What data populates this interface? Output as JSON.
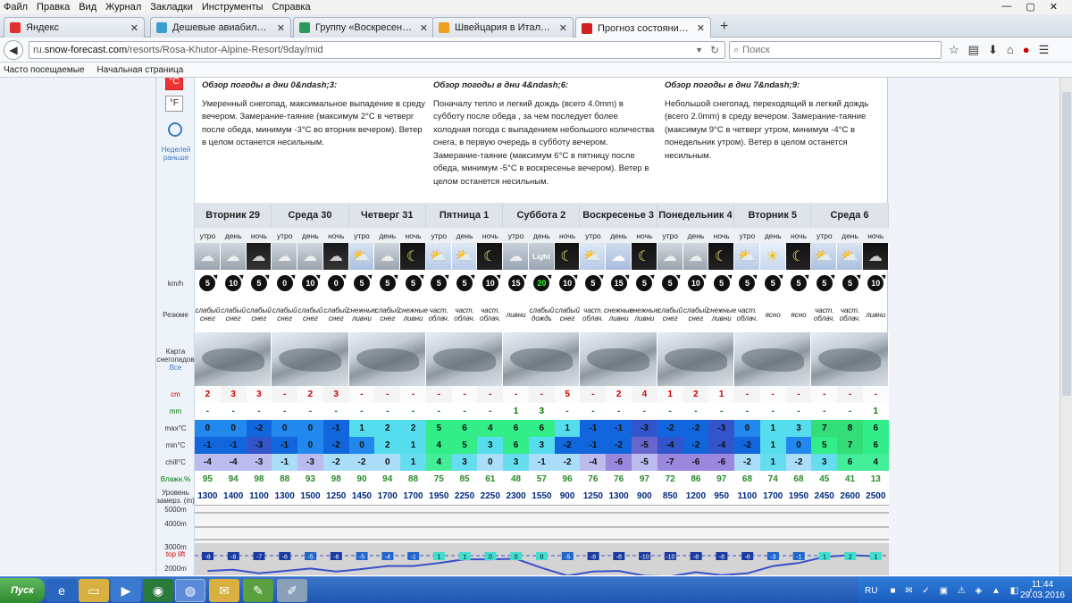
{
  "menu": [
    "Файл",
    "Правка",
    "Вид",
    "Журнал",
    "Закладки",
    "Инструменты",
    "Справка"
  ],
  "tabs": [
    {
      "title": "Яндекс",
      "color": "#e03030"
    },
    {
      "title": "Дешевые авиабилеты Моск...",
      "color": "#3aa0d0"
    },
    {
      "title": "Группу «Воскресенье» заки...",
      "color": "#2a9a5a"
    },
    {
      "title": "Швейцария в Италии, или н...",
      "color": "#f0a020"
    },
    {
      "title": "Прогноз состояния снега и ...",
      "color": "#d02020"
    }
  ],
  "url": {
    "prefix": "ru.",
    "host": "snow-forecast.com",
    "path": "/resorts/Rosa-Khutor-Alpine-Resort/9day/mid"
  },
  "search_placeholder": "Поиск",
  "bookmarks": [
    "Часто посещаемые",
    "Начальная страница"
  ],
  "left_panel": {
    "c_label": "°C",
    "f_label": "°F",
    "earlier": "Неделей раньше"
  },
  "overview": [
    {
      "title": "Обзор погоды в дни 0&ndash;3:",
      "text": "Умеренный снегопад, максимальное выпадение в среду вечером. Замерание-таяние (максимум 2°C в четверг после обеда, минимум -3°C во вторник вечером). Ветер в целом останется несильным."
    },
    {
      "title": "Обзор погоды в дни 4&ndash;6:",
      "text": "Поначалу тепло и легкий дождь (всего 4.0mm) в субботу после обеда , за чем последует более холодная погода с выпадением небольшого количества снега, в первую очередь в субботу вечером. Замерание-таяние (максимум 6°C в пятницу после обеда, минимум -5°C в воскресенье вечером). Ветер в целом останется несильным."
    },
    {
      "title": "Обзор погоды в дни 7&ndash;9:",
      "text": "Небольшой снегопад, переходящий в легкий дождь (всего 2.0mm) в среду вечером. Замерание-таяние (максимум 9°C в четверг утром, минимум -4°C в понедельник утром). Ветер в целом останется несильным."
    }
  ],
  "row_labels": {
    "wind": "km/h",
    "summary": "Резюме",
    "map": "Карта снегопадов",
    "map_link": "Все",
    "snow": "cm",
    "rain": "mm",
    "max": "max°C",
    "min": "min°C",
    "chill": "chill°C",
    "humidity": "Влажн.%",
    "freezing": "Уровень замерз. (m)",
    "top_lift": "top lift"
  },
  "days": [
    "Вторник 29",
    "Среда 30",
    "Четверг 31",
    "Пятница 1",
    "Суббота 2",
    "Воскресенье 3",
    "Понедельник 4",
    "Вторник 5",
    "Среда 6"
  ],
  "periods": [
    "утро",
    "день",
    "ночь"
  ],
  "weather_types": [
    "snow",
    "snow",
    "snow-night",
    "snow",
    "snow",
    "snow-night",
    "cloud-sun",
    "snow",
    "moon",
    "sun-cloud",
    "sun-cloud",
    "moon",
    "cloud-light",
    "cloud-light",
    "moon",
    "sun-cloud",
    "cloud-snow",
    "moon",
    "snow",
    "snow",
    "moon",
    "sun-cloud",
    "sun",
    "moon",
    "cloud-sun",
    "cloud-sun",
    "rain-night"
  ],
  "light_label": "Light",
  "wind": [
    "5",
    "10",
    "5",
    "0",
    "10",
    "0",
    "5",
    "5",
    "5",
    "5",
    "5",
    "10",
    "15",
    "20",
    "10",
    "5",
    "15",
    "5",
    "5",
    "10",
    "5",
    "5",
    "5",
    "5",
    "5",
    "5",
    "10"
  ],
  "summary": [
    "слабый снег",
    "слабый снег",
    "слабый снег",
    "слабый снег",
    "слабый снег",
    "слабый снег",
    "снежные ливни",
    "слабый снег",
    "снежные ливни",
    "част. облач.",
    "част. облач.",
    "част. облач.",
    "ливни",
    "слабый дождь",
    "слабый снег",
    "част. облач.",
    "снежные ливни",
    "снежные ливни",
    "слабый снег",
    "слабый снег",
    "снежные ливни",
    "част. облач.",
    "ясно",
    "ясно",
    "част. облач.",
    "част. облач.",
    "ливни"
  ],
  "snow": [
    "2",
    "3",
    "3",
    "-",
    "2",
    "3",
    "-",
    "-",
    "-",
    "-",
    "-",
    "-",
    "-",
    "-",
    "5",
    "-",
    "2",
    "4",
    "1",
    "2",
    "1",
    "-",
    "-",
    "-",
    "-",
    "-",
    "-"
  ],
  "rain": [
    "-",
    "-",
    "-",
    "-",
    "-",
    "-",
    "-",
    "-",
    "-",
    "-",
    "-",
    "-",
    "1",
    "3",
    "-",
    "-",
    "-",
    "-",
    "-",
    "-",
    "-",
    "-",
    "-",
    "-",
    "-",
    "-",
    "1"
  ],
  "max": [
    "0",
    "0",
    "-2",
    "0",
    "0",
    "-1",
    "1",
    "2",
    "2",
    "5",
    "6",
    "4",
    "6",
    "6",
    "1",
    "-1",
    "-1",
    "-3",
    "-2",
    "-2",
    "-3",
    "0",
    "1",
    "3",
    "7",
    "8",
    "6"
  ],
  "min": [
    "-1",
    "-1",
    "-3",
    "-1",
    "0",
    "-2",
    "0",
    "2",
    "1",
    "4",
    "5",
    "3",
    "6",
    "3",
    "-2",
    "-1",
    "-2",
    "-5",
    "-4",
    "-2",
    "-4",
    "-2",
    "1",
    "0",
    "5",
    "7",
    "6"
  ],
  "chill": [
    "-4",
    "-4",
    "-3",
    "-1",
    "-3",
    "-2",
    "-2",
    "0",
    "1",
    "4",
    "3",
    "0",
    "3",
    "-1",
    "-2",
    "-4",
    "-6",
    "-5",
    "-7",
    "-6",
    "-6",
    "-2",
    "1",
    "-2",
    "3",
    "6",
    "4"
  ],
  "humidity": [
    "95",
    "94",
    "98",
    "88",
    "93",
    "98",
    "90",
    "94",
    "88",
    "75",
    "85",
    "61",
    "48",
    "57",
    "96",
    "76",
    "76",
    "97",
    "72",
    "86",
    "97",
    "68",
    "74",
    "68",
    "45",
    "41",
    "13"
  ],
  "freezing": [
    "1300",
    "1400",
    "1100",
    "1300",
    "1500",
    "1250",
    "1450",
    "1700",
    "1700",
    "1950",
    "2250",
    "2250",
    "2300",
    "1550",
    "900",
    "1250",
    "1300",
    "900",
    "850",
    "1200",
    "950",
    "1100",
    "1700",
    "1950",
    "2450",
    "2600",
    "2500"
  ],
  "chart_alt_labels": [
    "5000m",
    "4000m",
    "3000m",
    "2000m"
  ],
  "chart_values": [
    "-8",
    "-8",
    "-7",
    "-6",
    "-5",
    "-6",
    "-5",
    "-4",
    "-1",
    "1",
    "1",
    "0",
    "0",
    "0",
    "-5",
    "-8",
    "-8",
    "-10",
    "-10",
    "-8",
    "-8",
    "-6",
    "-3",
    "-1",
    "1",
    "2",
    "1"
  ],
  "taskbar": {
    "start": "Пуск",
    "lang": "RU",
    "time": "11:44",
    "date": "29.03.2016"
  }
}
